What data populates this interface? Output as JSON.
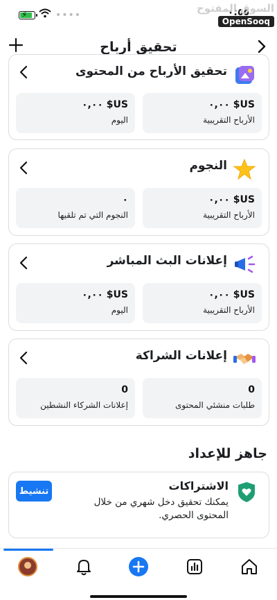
{
  "status_bar": {
    "clock": "٠:٥٥",
    "watermark_ar": "السوق المفتوح",
    "watermark_en": "OpenSooq",
    "battery_level": 0.75
  },
  "header": {
    "title": "تحقيق أرباح"
  },
  "cards": {
    "content": {
      "title": "تحقيق الأرباح من المحتوى",
      "stat1": {
        "value": "US$ ٠,٠٠",
        "label": "الأرباح التقريبية"
      },
      "stat2": {
        "value": "US$ ٠,٠٠",
        "label": "اليوم"
      }
    },
    "stars": {
      "title": "النجوم",
      "stat1": {
        "value": "US$ ٠,٠٠",
        "label": "الأرباح التقريبية"
      },
      "stat2": {
        "value": "٠",
        "label": "النجوم التي تم تلقيها"
      }
    },
    "live_ads": {
      "title": "إعلانات البث المباشر",
      "stat1": {
        "value": "US$ ٠,٠٠",
        "label": "الأرباح التقريبية"
      },
      "stat2": {
        "value": "US$ ٠,٠٠",
        "label": "اليوم"
      }
    },
    "partnership": {
      "title": "إعلانات الشراكة",
      "stat1": {
        "value": "0",
        "label": "طلبات منشئي المحتوى"
      },
      "stat2": {
        "value": "0",
        "label": "إعلانات الشركاء النشطين"
      }
    }
  },
  "section": {
    "title": "جاهز للإعداد"
  },
  "subscriptions": {
    "title": "الاشتراكات",
    "description": "يمكنك تحقيق دخل شهري من خلال المحتوى الحصري.",
    "button": "تنشيط"
  },
  "colors": {
    "accent": "#1877f2",
    "stat_bg": "#f2f3f5",
    "battery": "#2fbe4a"
  },
  "icons": {
    "header_left": "plus-icon",
    "header_right": "chevron-right-icon",
    "nav": [
      "profile-avatar",
      "bell-icon",
      "create-plus-icon",
      "insights-icon",
      "home-icon"
    ]
  }
}
